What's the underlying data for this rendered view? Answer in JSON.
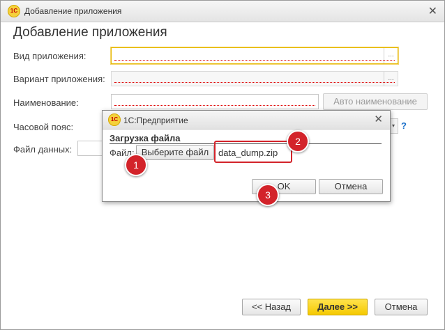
{
  "window": {
    "title": "Добавление приложения",
    "logo": "1С"
  },
  "header": "Добавление приложения",
  "form": {
    "app_type_label": "Вид приложения:",
    "app_variant_label": "Вариант приложения:",
    "name_label": "Наименование:",
    "auto_name_button": "Авто наименование",
    "timezone_label": "Часовой пояс:",
    "data_file_label": "Файл данных:",
    "help_mark": "?"
  },
  "footer": {
    "back": "<< Назад",
    "next": "Далее >>",
    "cancel": "Отмена"
  },
  "dialog": {
    "title": "1С:Предприятие",
    "group_title": "Загрузка файла",
    "file_label": "Файл:",
    "choose_button": "Выберите файл",
    "file_name": "data_dump.zip",
    "ok": "OK",
    "cancel": "Отмена"
  },
  "annotations": [
    "1",
    "2",
    "3"
  ],
  "colors": {
    "accent_yellow": "#f5c900",
    "marker_red": "#d3232a",
    "help_blue": "#1a6fc9"
  },
  "icons": {
    "close": "close-icon",
    "select": "ellipsis-icon",
    "logo": "1c-logo-icon"
  }
}
